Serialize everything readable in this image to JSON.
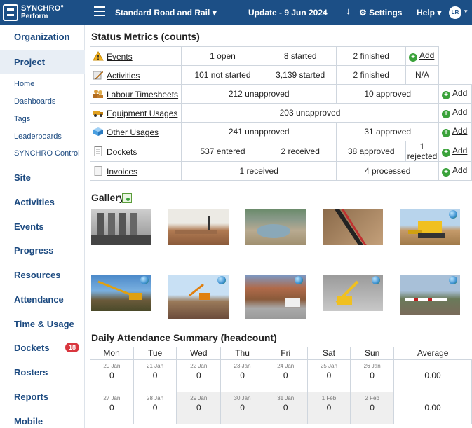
{
  "app": {
    "logo_line1": "SYNCHRO°",
    "logo_line2": "Perform",
    "project": "Standard Road and Rail",
    "update": "Update - 9 Jun 2024",
    "settings_label": "Settings",
    "help_label": "Help",
    "user_initials": "LR"
  },
  "sidebar": {
    "organization": "Organization",
    "project": "Project",
    "sub": [
      "Home",
      "Dashboards",
      "Tags",
      "Leaderboards",
      "SYNCHRO Control"
    ],
    "site": "Site",
    "activities": "Activities",
    "events": "Events",
    "progress": "Progress",
    "resources": "Resources",
    "attendance": "Attendance",
    "time_usage": "Time & Usage",
    "dockets": "Dockets",
    "dockets_badge": "18",
    "rosters": "Rosters",
    "reports": "Reports",
    "mobile": "Mobile"
  },
  "status": {
    "title": "Status Metrics (counts)",
    "add_label": "Add",
    "na_label": "N/A",
    "events": {
      "name": "Events",
      "c1": "1 open",
      "c2": "8 started",
      "c3": "2 finished"
    },
    "activities": {
      "name": "Activities",
      "c1": "101 not started",
      "c2": "3,139 started",
      "c3": "2 finished"
    },
    "labour": {
      "name": "Labour Timesheets",
      "c1": "212 unapproved",
      "c2": "10 approved"
    },
    "equipment": {
      "name": "Equipment Usages",
      "c1": "203 unapproved"
    },
    "other": {
      "name": "Other Usages",
      "c1": "241 unapproved",
      "c2": "31 approved"
    },
    "dockets": {
      "name": "Dockets",
      "c1": "537 entered",
      "c2": "2 received",
      "c3": "38 approved",
      "c4": "1 rejected"
    },
    "invoices": {
      "name": "Invoices",
      "c1": "1 received",
      "c2": "4 processed"
    }
  },
  "gallery": {
    "title": "Gallery"
  },
  "attendance": {
    "title": "Daily Attendance Summary (headcount)",
    "headers": [
      "Mon",
      "Tue",
      "Wed",
      "Thu",
      "Fri",
      "Sat",
      "Sun",
      "Average"
    ],
    "week1_dates": [
      "20 Jan",
      "21 Jan",
      "22 Jan",
      "23 Jan",
      "24 Jan",
      "25 Jan",
      "26 Jan"
    ],
    "week1_values": [
      "0",
      "0",
      "0",
      "0",
      "0",
      "0",
      "0"
    ],
    "week1_avg": "0.00",
    "week2_dates": [
      "27 Jan",
      "28 Jan",
      "29 Jan",
      "30 Jan",
      "31 Jan",
      "1 Feb",
      "2 Feb"
    ],
    "week2_values": [
      "0",
      "0",
      "0",
      "0",
      "0",
      "0",
      "0"
    ],
    "week2_avg": "0.00"
  },
  "colors": {
    "topbar": "#1c4f86",
    "nav_text": "#1c4a80",
    "badge": "#d9363e",
    "add_icon": "#3aa23a"
  }
}
